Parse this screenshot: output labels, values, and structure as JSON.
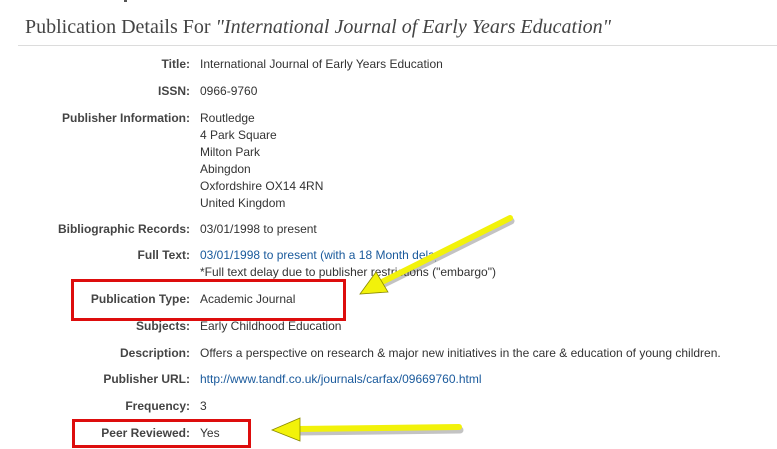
{
  "header": {
    "prefix": "Publication Details For",
    "journal_title": "\"International Journal of Early Years Education\""
  },
  "details": {
    "title": {
      "label": "Title:",
      "value": "International Journal of Early Years Education"
    },
    "issn": {
      "label": "ISSN:",
      "value": "0966-9760"
    },
    "publisher": {
      "label": "Publisher Information:",
      "lines": [
        "Routledge",
        "4 Park Square",
        "Milton Park",
        "Abingdon",
        "Oxfordshire OX14 4RN",
        "United Kingdom"
      ]
    },
    "bibliographic": {
      "label": "Bibliographic Records:",
      "value": "03/01/1998 to present"
    },
    "full_text": {
      "label": "Full Text:",
      "link": "03/01/1998 to present (with a 18 Month delay)",
      "note": "*Full text delay due to publisher restrictions (\"embargo\")"
    },
    "publication_type": {
      "label": "Publication Type:",
      "value": "Academic Journal"
    },
    "subjects": {
      "label": "Subjects:",
      "value": "Early Childhood Education"
    },
    "description": {
      "label": "Description:",
      "value": "Offers a perspective on research & major new initiatives in the care & education of young children."
    },
    "publisher_url": {
      "label": "Publisher URL:",
      "value": "http://www.tandf.co.uk/journals/carfax/09669760.html"
    },
    "frequency": {
      "label": "Frequency:",
      "value": "3"
    },
    "peer_reviewed": {
      "label": "Peer Reviewed:",
      "value": "Yes"
    }
  },
  "annotations": {
    "box_color": "#dd0d0d",
    "arrow_color": "#f2f20a"
  }
}
